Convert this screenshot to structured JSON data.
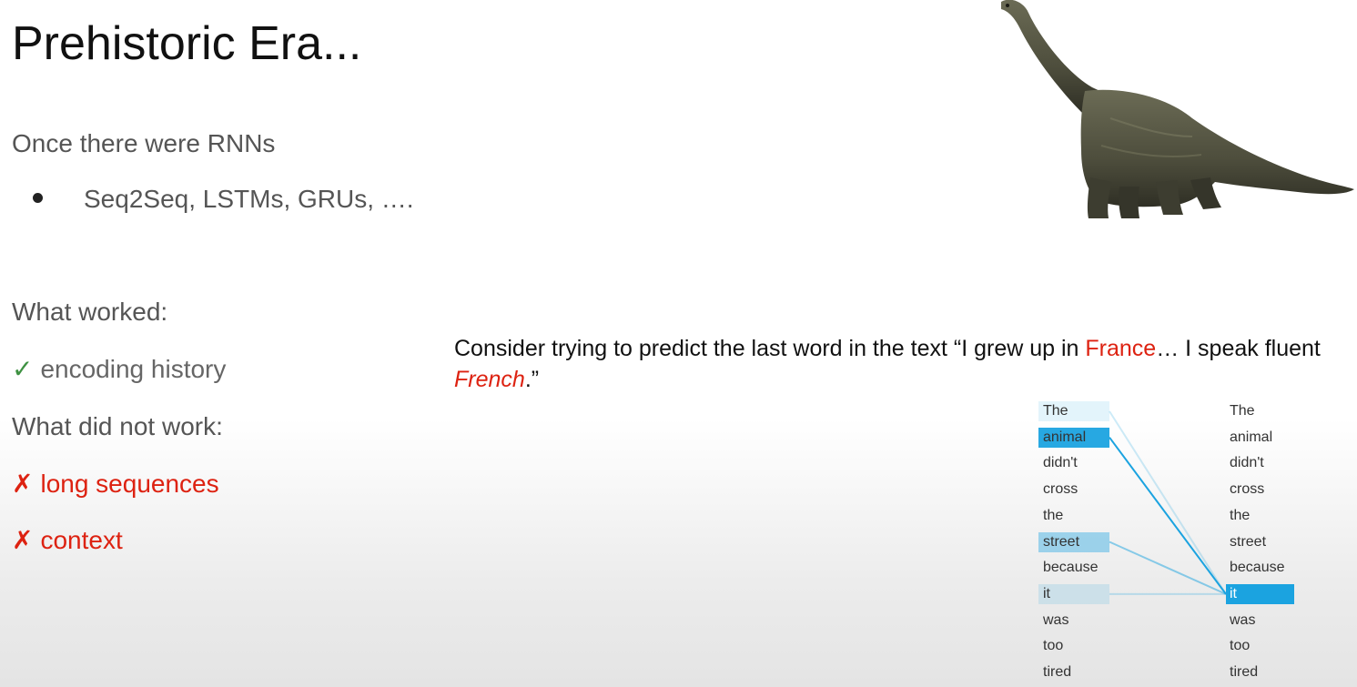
{
  "slide": {
    "title": "Prehistoric Era...",
    "subtitle": "Once there were RNNs",
    "bullet": "Seq2Seq, LSTMs, GRUs, ….",
    "worked_heading": "What worked:",
    "worked_items": [
      {
        "icon": "check-icon",
        "mark": "✓",
        "text": "encoding history"
      }
    ],
    "not_worked_heading": "What did not work:",
    "not_worked_items": [
      {
        "icon": "cross-icon",
        "mark": "✗",
        "text": "long sequences"
      },
      {
        "icon": "cross-icon",
        "mark": "✗",
        "text": "context"
      }
    ],
    "consider": {
      "part1": "Consider trying to predict the last word in the text “I grew up in ",
      "france": "France",
      "part2": "… I speak fluent ",
      "french": "French",
      "part3": ".”"
    }
  },
  "attention": {
    "left_words": [
      "The",
      "animal",
      "didn't",
      "cross",
      "the",
      "street",
      "because",
      "it",
      "was",
      "too",
      "tired"
    ],
    "right_words": [
      "The",
      "animal",
      "didn't",
      "cross",
      "the",
      "street",
      "because",
      "it",
      "was",
      "too",
      "tired"
    ],
    "query_index": 7,
    "weights": [
      0.12,
      0.95,
      0.0,
      0.0,
      0.0,
      0.4,
      0.0,
      0.15,
      0.0,
      0.0,
      0.0
    ]
  },
  "colors": {
    "accent_red": "#dd2211",
    "check_green": "#3e9142",
    "attention_blue": "#1ba3e0"
  },
  "image": {
    "icon": "dinosaur-icon"
  }
}
